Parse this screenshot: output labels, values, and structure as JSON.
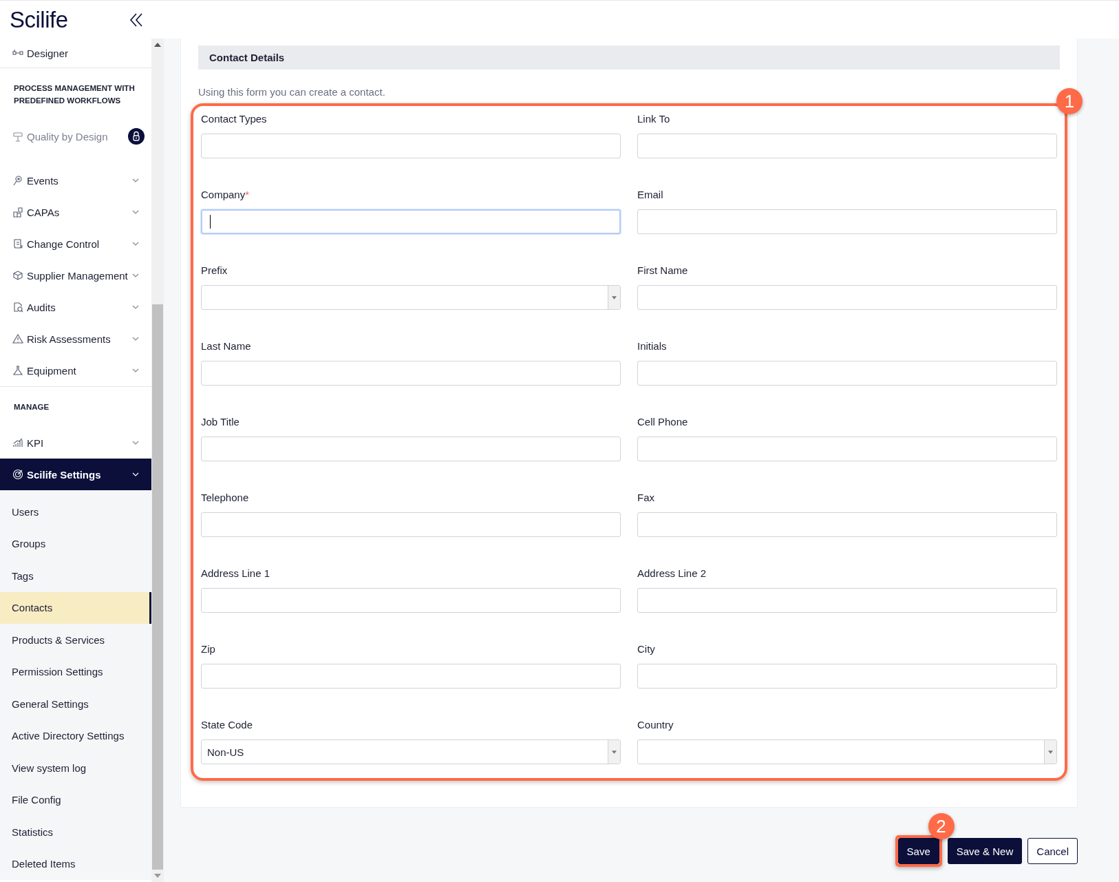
{
  "brand": "Scilife",
  "sidebar": {
    "items": [
      {
        "kind": "link",
        "label": "Designer",
        "selected": false
      },
      {
        "kind": "heading",
        "label": "PROCESS MANAGEMENT WITH PREDEFINED WORKFLOWS"
      },
      {
        "kind": "locked",
        "label": "Quality by Design",
        "selected": false
      },
      {
        "kind": "group",
        "label": "Events",
        "selected": false
      },
      {
        "kind": "group",
        "label": "CAPAs",
        "selected": false
      },
      {
        "kind": "group",
        "label": "Change Control",
        "selected": false
      },
      {
        "kind": "group",
        "label": "Supplier Management",
        "selected": false
      },
      {
        "kind": "group",
        "label": "Audits",
        "selected": false
      },
      {
        "kind": "group",
        "label": "Risk Assessments",
        "selected": false
      },
      {
        "kind": "group",
        "label": "Equipment",
        "selected": false
      },
      {
        "kind": "heading",
        "label": "MANAGE"
      },
      {
        "kind": "group",
        "label": "KPI",
        "selected": false
      },
      {
        "kind": "group",
        "label": "Scilife Settings",
        "selected": true,
        "children": [
          {
            "label": "Users",
            "selected": false
          },
          {
            "label": "Groups",
            "selected": false
          },
          {
            "label": "Tags",
            "selected": false
          },
          {
            "label": "Contacts",
            "selected": true
          },
          {
            "label": "Products & Services",
            "selected": false
          },
          {
            "label": "Permission Settings",
            "selected": false
          },
          {
            "label": "General Settings",
            "selected": false
          },
          {
            "label": "Active Directory Settings",
            "selected": false
          },
          {
            "label": "View system log",
            "selected": false
          },
          {
            "label": "File Config",
            "selected": false
          },
          {
            "label": "Statistics",
            "selected": false
          },
          {
            "label": "Deleted Items",
            "selected": false
          }
        ]
      }
    ]
  },
  "form": {
    "title": "Contact Details",
    "intro": "Using this form you can create a contact.",
    "callout": "1",
    "fields": [
      {
        "label": "Contact Types",
        "kind": "text",
        "focused": false
      },
      {
        "label": "Link To",
        "kind": "text",
        "focused": false
      },
      {
        "label": "Company",
        "mark": "*",
        "kind": "text",
        "focused": true
      },
      {
        "label": "Email",
        "kind": "text",
        "focused": false
      },
      {
        "label": "Prefix",
        "kind": "select",
        "focused": false
      },
      {
        "label": "First Name",
        "kind": "text",
        "focused": false
      },
      {
        "label": "Last Name",
        "kind": "text",
        "focused": false
      },
      {
        "label": "Initials",
        "kind": "text",
        "focused": false
      },
      {
        "label": "Job Title",
        "kind": "text",
        "focused": false
      },
      {
        "label": "Cell Phone",
        "kind": "text",
        "focused": false
      },
      {
        "label": "Telephone",
        "kind": "text",
        "focused": false
      },
      {
        "label": "Fax",
        "kind": "text",
        "focused": false
      },
      {
        "label": "Address Line 1",
        "kind": "text",
        "focused": false
      },
      {
        "label": "Address Line 2",
        "kind": "text",
        "focused": false
      },
      {
        "label": "Zip",
        "kind": "text",
        "focused": false
      },
      {
        "label": "City",
        "kind": "text",
        "focused": false
      },
      {
        "label": "State Code",
        "kind": "select",
        "value": "Non-US",
        "focused": false
      },
      {
        "label": "Country",
        "kind": "select",
        "focused": false
      }
    ]
  },
  "buttons": [
    {
      "label": "Save",
      "kind": "primary",
      "callout": "2"
    },
    {
      "label": "Save & New",
      "kind": "primary"
    },
    {
      "label": "Cancel",
      "kind": "secondary"
    }
  ]
}
